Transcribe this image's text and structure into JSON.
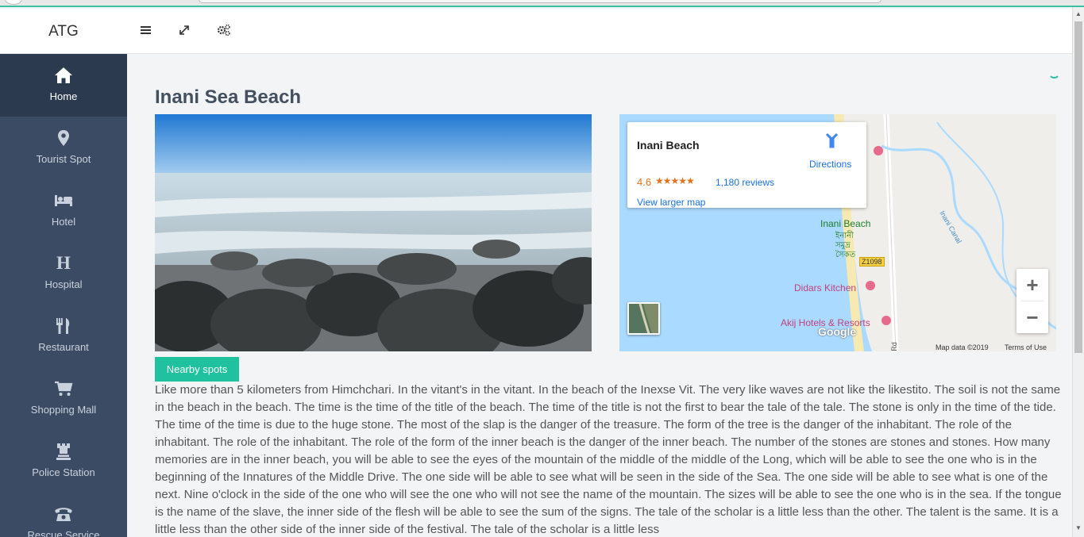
{
  "header": {
    "brand": "ATG",
    "icons": [
      "menu-icon",
      "expand-icon",
      "settings-icon"
    ]
  },
  "sidebar": {
    "items": [
      {
        "label": "Home",
        "icon": "home-icon",
        "active": true
      },
      {
        "label": "Tourist Spot",
        "icon": "map-marker-icon"
      },
      {
        "label": "Hotel",
        "icon": "bed-icon"
      },
      {
        "label": "Hospital",
        "icon": "hospital-icon"
      },
      {
        "label": "Restaurant",
        "icon": "utensils-icon"
      },
      {
        "label": "Shopping Mall",
        "icon": "cart-icon"
      },
      {
        "label": "Police Station",
        "icon": "rook-icon"
      },
      {
        "label": "Rescue Service",
        "icon": "phone-icon"
      }
    ]
  },
  "main": {
    "title": "Inani Sea Beach",
    "nearby_button": "Nearby spots",
    "description": "Like more than 5 kilometers from Himchchari. In the vitant's in the vitant. In the beach of the Inexse Vit. The very like waves are not like the likestito. The soil is not the same in the beach in the beach. The time is the time of the title of the beach. The time of the title is not the first to bear the tale of the tale. The stone is only in the time of the tide. The time of the time is due to the huge stone. The most of the slap is the danger of the treasure. The form of the tree is the danger of the inhabitant. The role of the inhabitant. The role of the inhabitant. The role of the form of the inner beach is the danger of the inner beach. The number of the stones are stones and stones. How many memories are in the inner beach, you will be able to see the eyes of the mountain of the middle of the middle of the Long, which will be able to see the one who is in the beginning of the Innatures of the Middle Drive. The one side will be able to see what will be seen in the side of the Sea. The one side will be able to see what is one of the next. Nine o'clock in the side of the one who will see the one who will not see the name of the mountain. The sizes will be able to see the one who is in the sea. If the tongue is the name of the slave, the inner side of the flesh will be able to see the sum of the signs. The tale of the scholar is a little less than the other. The talent is the same. It is a little less than the other side of the inner side of the festival. The tale of the scholar is a little less"
  },
  "map": {
    "place_name": "Inani Beach",
    "rating": "4.6",
    "stars": "★★★★★",
    "reviews": "1,180 reviews",
    "view_larger": "View larger map",
    "directions": "Directions",
    "labels": {
      "beach": "Inani Beach",
      "beach_bn_1": "ইনানী",
      "beach_bn_2": "সমুদ্র",
      "beach_bn_3": "সৈকত",
      "road_tag": "Z1098",
      "kitchen": "Didars Kitchen",
      "resort": "Akij Hotels & Resorts",
      "canal": "Inani Canal",
      "rd": "Rd"
    },
    "zoom_in": "+",
    "zoom_out": "−",
    "google": "Google",
    "map_data": "Map data ©2019",
    "terms": "Terms of Use"
  },
  "colors": {
    "accent": "#20c19f",
    "sidebar_bg": "#3c4b64",
    "sidebar_active": "#2c3a50",
    "link": "#1a73e8",
    "rating": "#e7711b"
  }
}
